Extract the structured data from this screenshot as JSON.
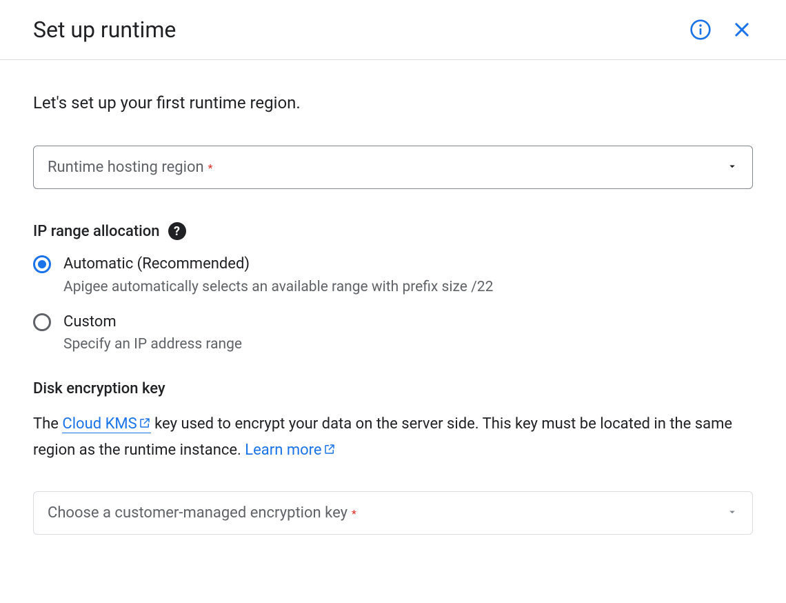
{
  "header": {
    "title": "Set up runtime"
  },
  "intro": "Let's set up your first runtime region.",
  "regionSelect": {
    "label": "Runtime hosting region"
  },
  "ipRange": {
    "heading": "IP range allocation",
    "options": [
      {
        "label": "Automatic (Recommended)",
        "desc": "Apigee automatically selects an available range with prefix size /22",
        "selected": true
      },
      {
        "label": "Custom",
        "desc": "Specify an IP address range",
        "selected": false
      }
    ]
  },
  "diskEncryption": {
    "heading": "Disk encryption key",
    "descPrefix": "The ",
    "linkCloudKms": "Cloud KMS",
    "descMiddle": " key used to encrypt your data on the server side. This key must be located in the same region as the runtime instance. ",
    "linkLearnMore": "Learn more"
  },
  "keySelect": {
    "label": "Choose a customer-managed encryption key"
  }
}
